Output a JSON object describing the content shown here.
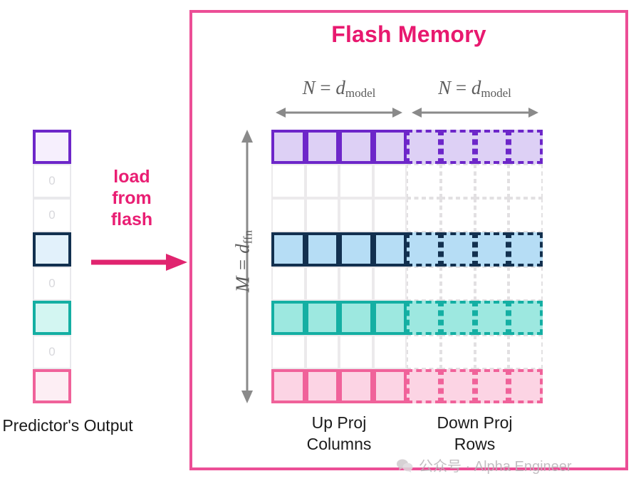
{
  "diagram": {
    "title": "Flash Memory",
    "title_color": "#e8196f",
    "frame_color": "#ec4e96"
  },
  "predictor": {
    "caption": "Predictor's\nOutput",
    "zero_label": "0",
    "cells": [
      {
        "kind": "active",
        "color_name": "purple",
        "border": "#6d26c9",
        "fill": "#f6effd",
        "label": ""
      },
      {
        "kind": "zero",
        "color_name": "grey",
        "border": "#e9e9ec",
        "fill": "#ffffff",
        "label": "0"
      },
      {
        "kind": "zero",
        "color_name": "grey",
        "border": "#e9e9ec",
        "fill": "#ffffff",
        "label": "0"
      },
      {
        "kind": "active",
        "color_name": "navy",
        "border": "#12304f",
        "fill": "#e2f1fb",
        "label": ""
      },
      {
        "kind": "zero",
        "color_name": "grey",
        "border": "#e9e9ec",
        "fill": "#ffffff",
        "label": "0"
      },
      {
        "kind": "active",
        "color_name": "teal",
        "border": "#14afa3",
        "fill": "#d3f6f2",
        "label": ""
      },
      {
        "kind": "zero",
        "color_name": "grey",
        "border": "#e9e9ec",
        "fill": "#ffffff",
        "label": "0"
      },
      {
        "kind": "active",
        "color_name": "pink",
        "border": "#f0629a",
        "fill": "#fdeef4",
        "label": ""
      }
    ]
  },
  "transfer": {
    "label": "load\nfrom\nflash",
    "label_color": "#e91e73",
    "arrow_color": "#e0246f",
    "arrow_icon": "right-arrow-icon"
  },
  "dimensions": {
    "width_left": {
      "var": "N",
      "eq": "=",
      "base": "d",
      "sub": "model"
    },
    "width_right": {
      "var": "N",
      "eq": "=",
      "base": "d",
      "sub": "model"
    },
    "height": {
      "var": "M",
      "eq": "=",
      "base": "d",
      "sub": "ffn"
    },
    "arrow_color": "#8a8a8a"
  },
  "matrix": {
    "rows": 8,
    "cols_per_half": 4,
    "left_caption": "Up Proj\nColumns",
    "right_caption": "Down Proj\nRows",
    "row_styles": [
      {
        "color_name": "purple",
        "active": true,
        "border": "#6d26c9",
        "fill": "#ddd0f5"
      },
      {
        "color_name": "grey",
        "active": false,
        "border": "#eceaec",
        "fill": "transparent"
      },
      {
        "color_name": "grey",
        "active": false,
        "border": "#eceaec",
        "fill": "transparent"
      },
      {
        "color_name": "navy",
        "active": true,
        "border": "#12304f",
        "fill": "#b6ddf5"
      },
      {
        "color_name": "grey",
        "active": false,
        "border": "#eceaec",
        "fill": "transparent"
      },
      {
        "color_name": "teal",
        "active": true,
        "border": "#14afa3",
        "fill": "#9de8e0"
      },
      {
        "color_name": "grey",
        "active": false,
        "border": "#eceaec",
        "fill": "transparent"
      },
      {
        "color_name": "pink",
        "active": true,
        "border": "#f0629a",
        "fill": "#fcd4e4"
      }
    ]
  },
  "watermark": {
    "text": "公众号 · Alpha Engineer",
    "icon": "wechat-icon",
    "color": "#b9b4b8"
  }
}
